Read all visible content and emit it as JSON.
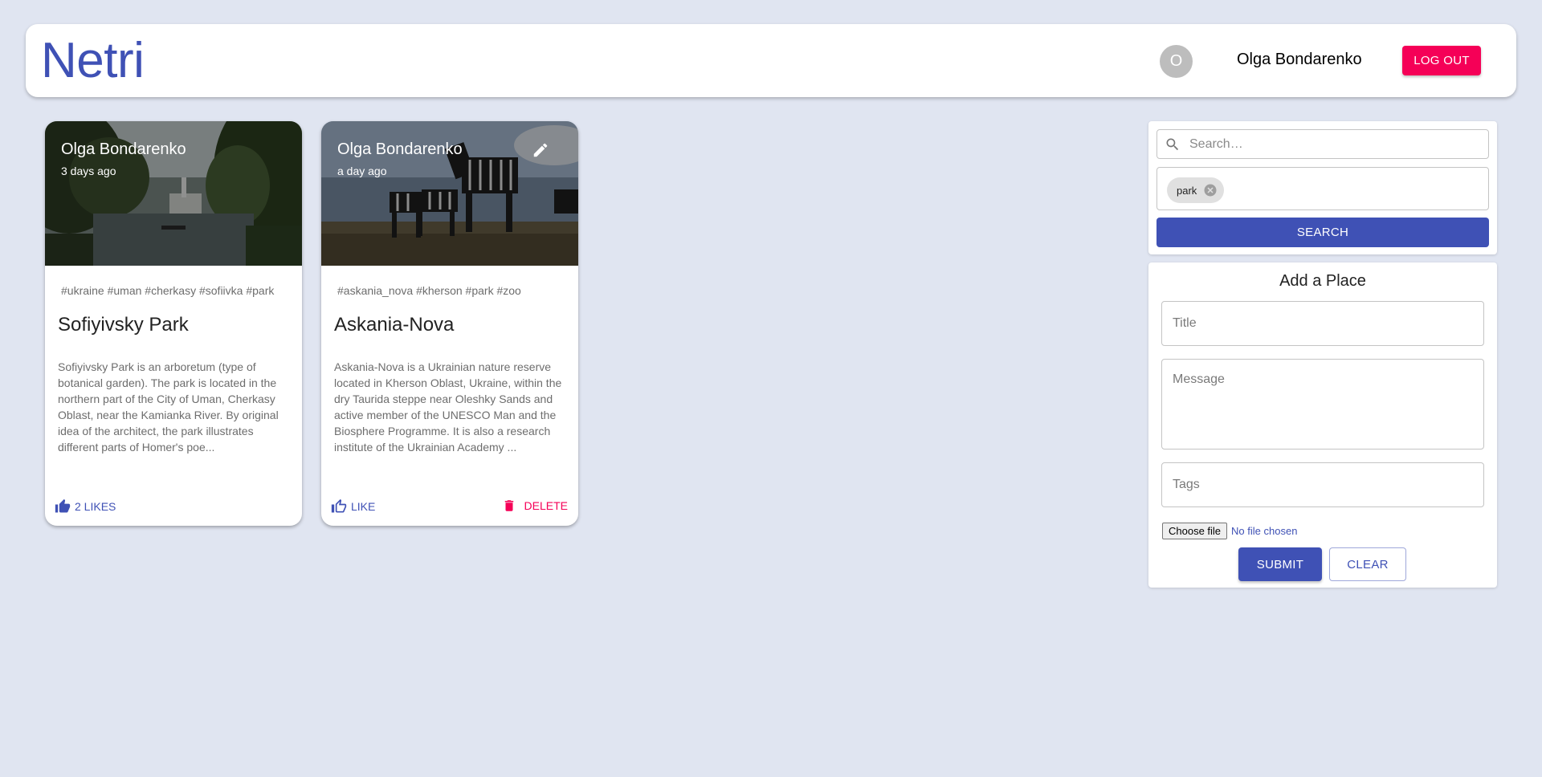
{
  "app": {
    "brand": "Netri"
  },
  "header": {
    "avatar_initial": "O",
    "user_name": "Olga Bondarenko",
    "logout_label": "LOG OUT"
  },
  "posts": [
    {
      "author": "Olga Bondarenko",
      "time": "3 days ago",
      "tags": "#ukraine #uman #cherkasy #sofiivka #park",
      "title": "Sofiyivsky Park",
      "message": "Sofiyivsky Park is an arboretum (type of botanical garden). The park is located in the northern part of the City of Uman, Cherkasy Oblast, near the Kamianka River. By original idea of the architect, the park illustrates different parts of Homer's poe...",
      "like_label": "2 LIKES",
      "image": "park-photo"
    },
    {
      "author": "Olga Bondarenko",
      "time": "a day ago",
      "tags": "#askania_nova #kherson #park #zoo",
      "title": "Askania-Nova",
      "message": "Askania-Nova is a Ukrainian nature reserve located in Kherson Oblast, Ukraine, within the dry Taurida steppe near Oleshky Sands and active member of the UNESCO Man and the Biosphere Programme. It is also a research institute of the Ukrainian Academy ...",
      "like_label": "LIKE",
      "delete_label": "DELETE",
      "image": "zebra-photo"
    }
  ],
  "search": {
    "placeholder": "Search…",
    "chip_tag": "park",
    "button_label": "SEARCH"
  },
  "form": {
    "heading": "Add a Place",
    "title_placeholder": "Title",
    "message_placeholder": "Message",
    "tags_placeholder": "Tags",
    "file_button": "Choose file",
    "file_status": "No file chosen",
    "submit_label": "SUBMIT",
    "clear_label": "CLEAR"
  },
  "colors": {
    "primary": "#3f51b5",
    "secondary": "#f50057",
    "background": "#e0e5f1"
  }
}
